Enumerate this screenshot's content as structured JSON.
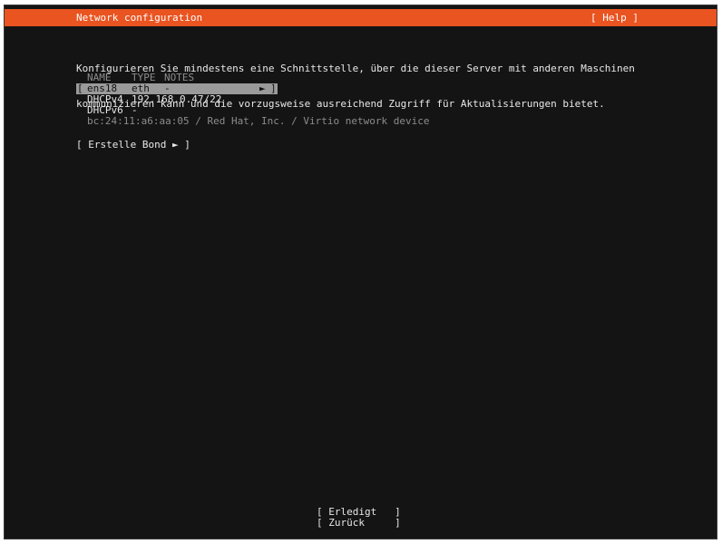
{
  "header": {
    "title": "Network configuration",
    "help_label": "[ Help ]"
  },
  "intro": {
    "line1": "Konfigurieren Sie mindestens eine Schnittstelle, über die dieser Server mit anderen Maschinen",
    "line2": "kommunizieren kann und die vorzugsweise ausreichend Zugriff für Aktualisierungen bietet."
  },
  "table": {
    "headers": {
      "name": "NAME",
      "type": "TYPE",
      "notes": "NOTES"
    },
    "interface": {
      "open_bracket": "[",
      "name": "ens18",
      "type": "eth",
      "notes": "-",
      "arrow": "►",
      "close_bracket": "]"
    },
    "dhcpv4": {
      "label": "DHCPv4",
      "value": "192.168.0.47/22"
    },
    "dhcpv6": {
      "label": "DHCPv6",
      "value": "-"
    },
    "device_info": "bc:24:11:a6:aa:05 / Red Hat, Inc. / Virtio network device"
  },
  "create_bond_label": "[ Erstelle Bond ► ]",
  "footer": {
    "done_label": "[ Erledigt   ]",
    "back_label": "[ Zurück     ]"
  }
}
